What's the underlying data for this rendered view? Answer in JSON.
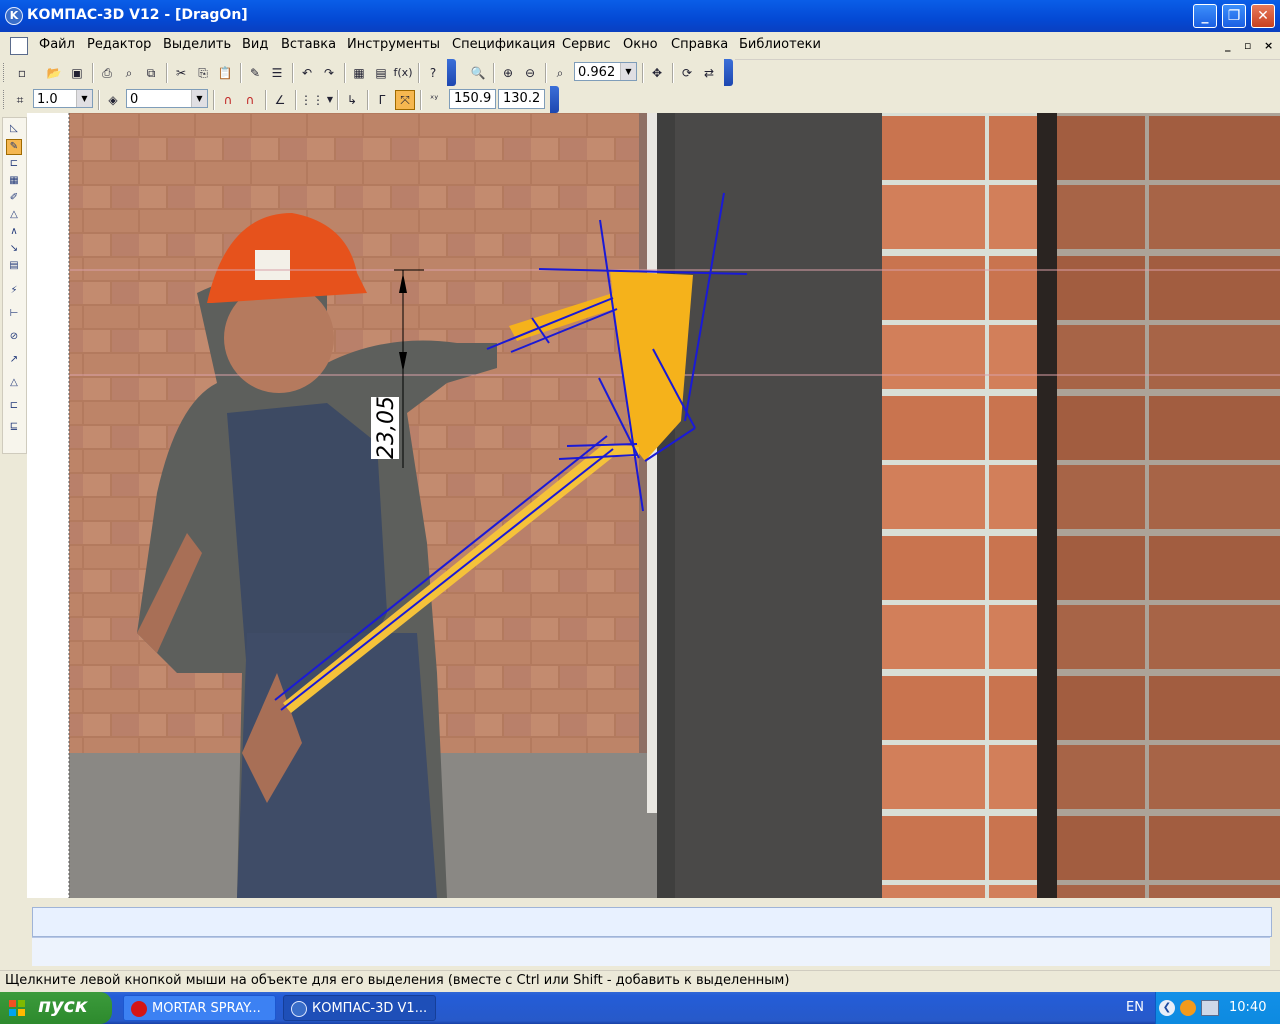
{
  "window": {
    "title": "КОМПАС-3D V12 - [DragOn]",
    "controls": {
      "minimize": "_",
      "maximize": "❐",
      "close": "✕"
    }
  },
  "menu": {
    "items": [
      "Файл",
      "Редактор",
      "Выделить",
      "Вид",
      "Вставка",
      "Инструменты",
      "Спецификация",
      "Сервис",
      "Окно",
      "Справка",
      "Библиотеки"
    ],
    "mdi_controls": [
      "_",
      "▫",
      "×"
    ]
  },
  "toolbar_standard": {
    "zoom_value": "0.962"
  },
  "toolbar_current_state": {
    "step_value": "1.0",
    "layer_value": "0",
    "cursor_x": "150.9",
    "cursor_y": "130.2"
  },
  "drawing": {
    "dimension_text": "23,05",
    "colors": {
      "construction_lines": "#1a1ad6",
      "fill": "#f5b21b",
      "horizontal_guides": "#d9a0a8"
    }
  },
  "status": {
    "message": "Щелкните левой кнопкой мыши на объекте для его выделения (вместе с Ctrl или Shift - добавить к выделенным)"
  },
  "taskbar": {
    "start_label": "пуск",
    "tasks": [
      {
        "label": "MORTAR SPRAY...",
        "icon": "opera-icon",
        "active": false
      },
      {
        "label": "КОМПАС-3D V1...",
        "icon": "kompas-icon",
        "active": true
      }
    ],
    "language": "EN",
    "time": "10:40"
  }
}
